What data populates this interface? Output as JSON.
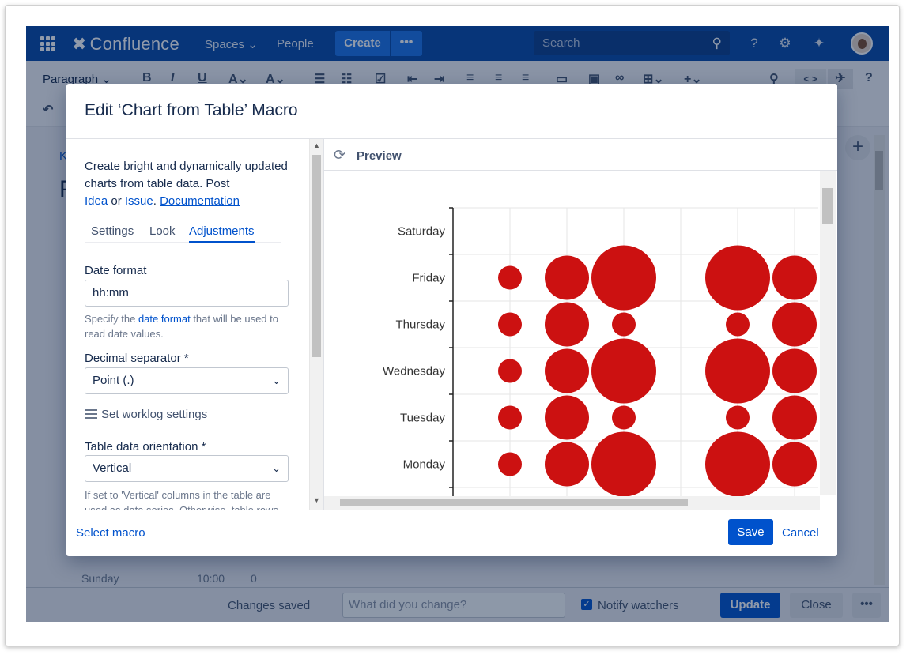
{
  "topnav": {
    "brand": "Confluence",
    "spaces": "Spaces",
    "people": "People",
    "create": "Create",
    "more": "•••",
    "search_placeholder": "Search"
  },
  "toolbar": {
    "paragraph": "Paragraph"
  },
  "page": {
    "breadcrumb": "Ka",
    "title": "P",
    "table_row": "Sunday",
    "table_value": "10:00",
    "table_value2": "0"
  },
  "footer": {
    "changes_saved": "Changes saved",
    "comment_placeholder": "What did you change?",
    "notify": "Notify watchers",
    "update": "Update",
    "close": "Close",
    "more": "•••"
  },
  "modal": {
    "title": "Edit ‘Chart from Table’ Macro",
    "desc_1": "Create bright and dynamically updated charts from table data. Post",
    "desc_idea": "Idea",
    "desc_or": " or ",
    "desc_issue": "Issue",
    "desc_dot": ". ",
    "desc_doc": "Documentation",
    "tabs": {
      "settings": "Settings",
      "look": "Look",
      "adjustments": "Adjustments"
    },
    "date_format_label": "Date format",
    "date_format_value": "hh:mm",
    "date_help_1": "Specify the ",
    "date_help_link": "date format",
    "date_help_2": " that will be used to read date values.",
    "decimal_label": "Decimal separator *",
    "decimal_value": "Point (.)",
    "worklog": "Set worklog settings",
    "orientation_label": "Table data orientation *",
    "orientation_value": "Vertical",
    "orientation_help": "If set to 'Vertical' columns in the table are used as data series. Otherwise, table rows",
    "preview": "Preview",
    "select_macro": "Select macro",
    "save": "Save",
    "cancel": "Cancel"
  },
  "colors": {
    "bubble": "#cc1111",
    "nav": "#0747a6",
    "primary": "#0052cc"
  },
  "chart_data": {
    "type": "scatter",
    "categories": [
      "Monday",
      "Tuesday",
      "Wednesday",
      "Thursday",
      "Friday",
      "Saturday"
    ],
    "columns": 6,
    "series": [
      {
        "values": [
          1,
          1,
          1,
          1,
          1,
          0
        ]
      },
      {
        "values": [
          2,
          2,
          2,
          2,
          2,
          0
        ]
      },
      {
        "values": [
          3,
          1,
          3,
          1,
          3,
          0
        ]
      },
      {
        "values": [
          0,
          0,
          0,
          0,
          0,
          0
        ]
      },
      {
        "values": [
          3,
          1,
          3,
          1,
          3,
          0
        ]
      },
      {
        "values": [
          2,
          2,
          2,
          2,
          2,
          0
        ]
      }
    ]
  }
}
